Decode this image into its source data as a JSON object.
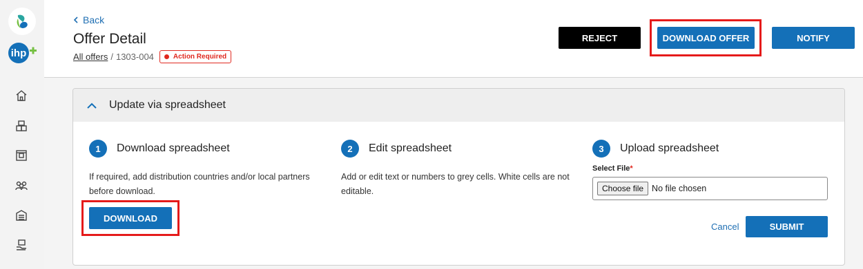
{
  "header": {
    "back_label": "Back",
    "title": "Offer Detail",
    "breadcrumb_link": "All offers",
    "breadcrumb_separator": "/",
    "breadcrumb_current": "1303-004",
    "badge_label": "Action Required"
  },
  "actions": {
    "reject_label": "REJECT",
    "download_offer_label": "DOWNLOAD OFFER",
    "notify_label": "NOTIFY"
  },
  "sidebar": {
    "logo_text": "ihp",
    "items": [
      "home-icon",
      "boxes-icon",
      "package-icon",
      "people-icon",
      "warehouse-icon",
      "hand-box-icon"
    ]
  },
  "panel": {
    "title": "Update via spreadsheet",
    "steps": [
      {
        "number": "1",
        "title": "Download spreadsheet",
        "description": "If required, add distribution countries and/or local partners before download.",
        "button_label": "DOWNLOAD"
      },
      {
        "number": "2",
        "title": "Edit spreadsheet",
        "description": "Add or edit text or numbers to grey cells. White cells are not editable."
      },
      {
        "number": "3",
        "title": "Upload spreadsheet",
        "select_label": "Select File",
        "required_mark": "*",
        "choose_file_label": "Choose file",
        "file_status": "No file chosen",
        "cancel_label": "Cancel",
        "submit_label": "SUBMIT"
      }
    ]
  },
  "colors": {
    "accent": "#1470b8",
    "danger": "#e0281f",
    "highlight": "#e51a1a"
  }
}
